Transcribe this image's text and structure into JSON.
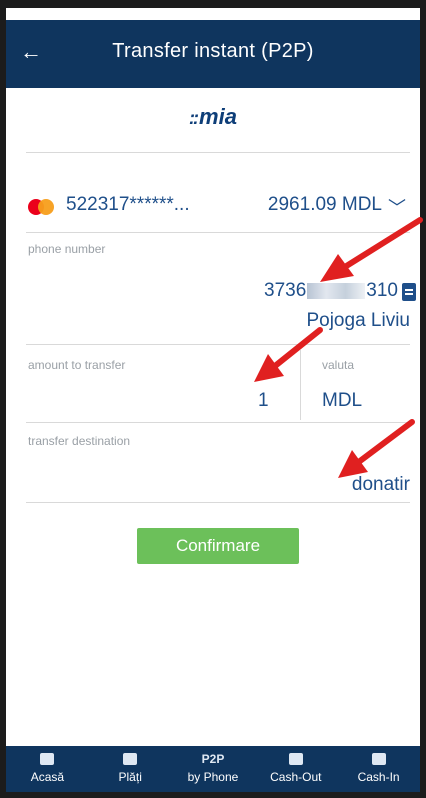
{
  "header": {
    "title": "Transfer instant (P2P)",
    "back_icon": "back-arrow-icon"
  },
  "logo": {
    "dots": "::",
    "text": "mia"
  },
  "card": {
    "number": "522317******...",
    "balance": "2961.09 MDL",
    "brand_icon": "mastercard-icon"
  },
  "phone": {
    "label": "phone number",
    "prefix": "3736",
    "suffix": "310",
    "contact_name": "Pojoga Liviu"
  },
  "amount": {
    "label": "amount to transfer",
    "value": "1",
    "currency_label": "valuta",
    "currency": "MDL"
  },
  "destination": {
    "label": "transfer destination",
    "value": "donatir"
  },
  "confirm_button": "Confirmare",
  "bottom_nav": [
    {
      "icon": "home-icon",
      "label": "Acasă"
    },
    {
      "icon": "wallet-icon",
      "label": "Plăți"
    },
    {
      "icon_text": "P2P",
      "label": "by Phone"
    },
    {
      "icon": "cash-out-icon",
      "label": "Cash-Out"
    },
    {
      "icon": "cash-in-icon",
      "label": "Cash-In"
    }
  ],
  "colors": {
    "header_bg": "#0f355e",
    "value_text": "#1f4f8a",
    "button_bg": "#6cc05a",
    "arrow": "#e02020"
  }
}
